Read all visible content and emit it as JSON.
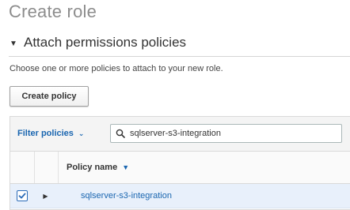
{
  "page": {
    "title": "Create role"
  },
  "section": {
    "title": "Attach permissions policies",
    "description": "Choose one or more policies to attach to your new role."
  },
  "actions": {
    "create_policy_label": "Create policy"
  },
  "filter": {
    "dropdown_label": "Filter policies",
    "search_value": "sqlserver-s3-integration"
  },
  "table": {
    "columns": [
      "Policy name"
    ],
    "rows": [
      {
        "checked": true,
        "name": "sqlserver-s3-integration"
      }
    ]
  },
  "icons": [
    "caret-down-icon",
    "chevron-down-icon",
    "search-icon",
    "sort-down-icon",
    "checkmark-icon",
    "expand-arrow-icon"
  ],
  "colors": {
    "link": "#1a66b0",
    "selected_row": "#e8f0fb",
    "title_gray": "#8d8d8d"
  }
}
